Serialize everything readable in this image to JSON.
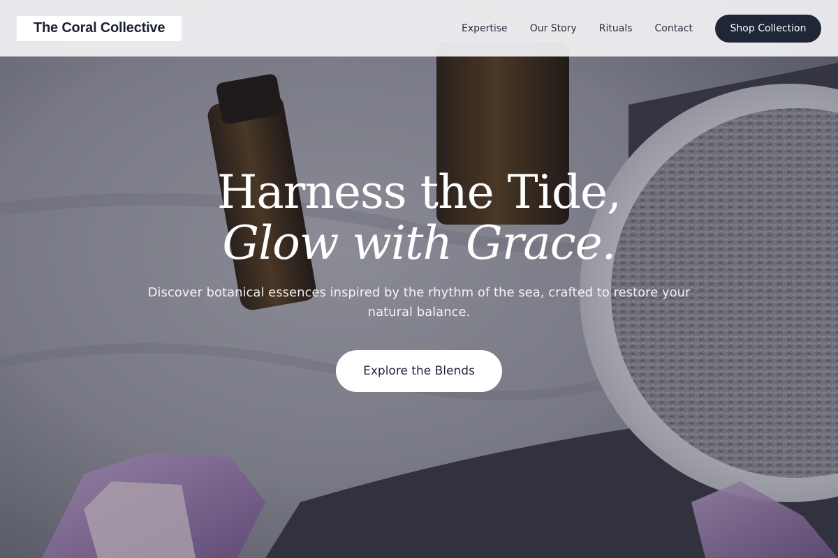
{
  "header": {
    "logo_text": "The Coral Collective",
    "nav": [
      {
        "label": "Expertise"
      },
      {
        "label": "Our Story"
      },
      {
        "label": "Rituals"
      },
      {
        "label": "Contact"
      }
    ],
    "shop_button_label": "Shop Collection"
  },
  "hero": {
    "title_line1": "Harness the Tide,",
    "title_line2": "Glow with Grace.",
    "subtitle": "Discover botanical essences inspired by the rhythm of the sea, crafted to restore your natural balance.",
    "cta_label": "Explore the Blends",
    "background_description_icons": [
      "amber-bottle",
      "lavender-bowl",
      "amethyst-crystal",
      "linen-cloth"
    ]
  },
  "colors": {
    "primary_dark": "#1e2637",
    "header_bg": "#f0f0f3",
    "text_light": "#ffffff"
  }
}
